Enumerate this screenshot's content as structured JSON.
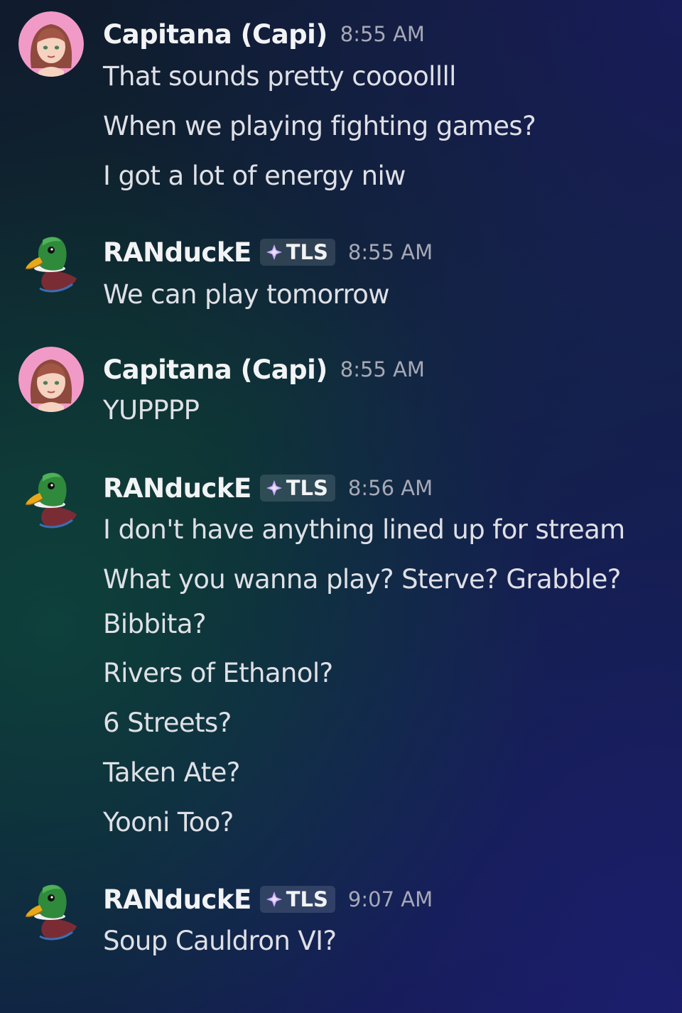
{
  "messages": [
    {
      "author": "Capitana (Capi)",
      "avatar_icon": "capi-avatar-icon",
      "tag": null,
      "time": "8:55 AM",
      "lines": [
        "That sounds pretty coooollll",
        "When we playing fighting games?",
        "I got a lot of energy niw"
      ]
    },
    {
      "author": "RANduckE",
      "avatar_icon": "duck-avatar-icon",
      "tag": "TLS",
      "time": "8:55 AM",
      "lines": [
        "We can play tomorrow"
      ]
    },
    {
      "author": "Capitana (Capi)",
      "avatar_icon": "capi-avatar-icon",
      "tag": null,
      "time": "8:55 AM",
      "lines": [
        "YUPPPP"
      ]
    },
    {
      "author": "RANduckE",
      "avatar_icon": "duck-avatar-icon",
      "tag": "TLS",
      "time": "8:56 AM",
      "lines": [
        "I don't have anything lined up for stream",
        "What you wanna play? Sterve? Grabble?",
        "Bibbita?",
        "Rivers of Ethanol?",
        "6 Streets?",
        "Taken Ate?",
        "Yooni Too?"
      ]
    },
    {
      "author": "RANduckE",
      "avatar_icon": "duck-avatar-icon",
      "tag": "TLS",
      "time": "9:07 AM",
      "lines": [
        "Soup Cauldron VI?"
      ]
    }
  ],
  "tag_icon": "sparkle-diamond-icon"
}
